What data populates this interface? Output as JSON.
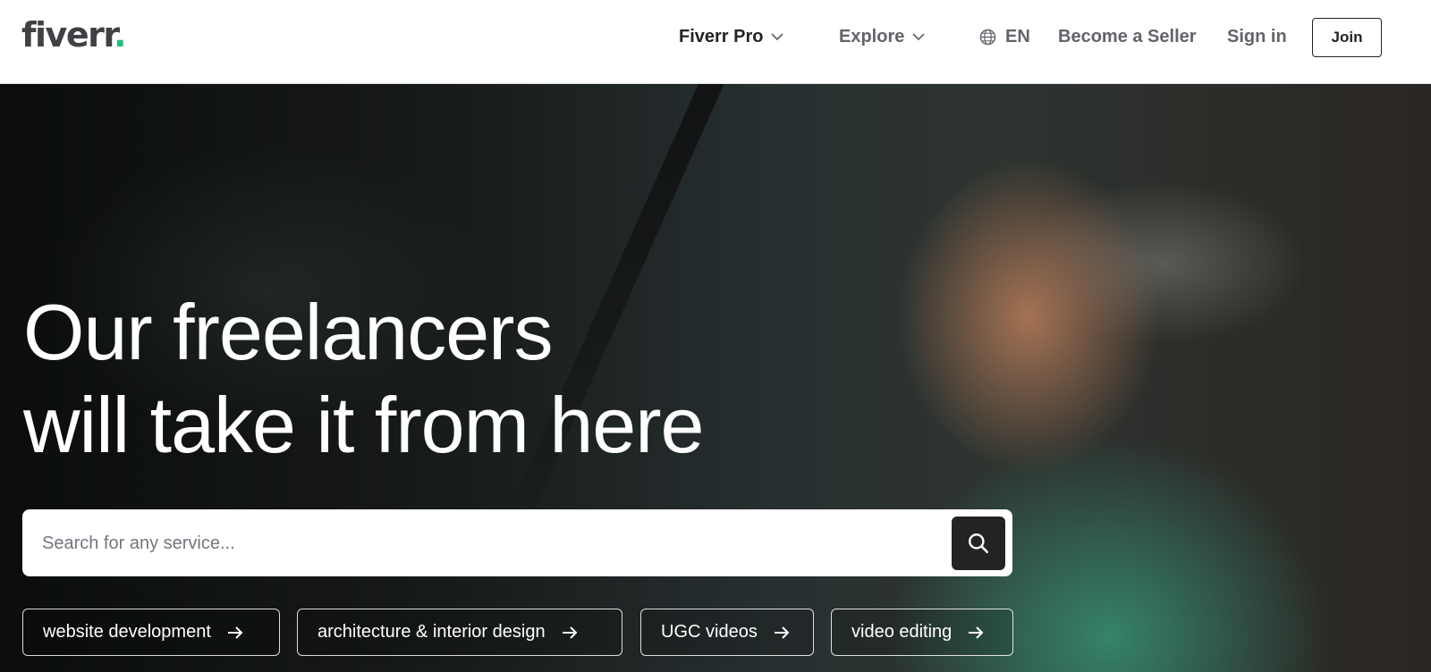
{
  "brand": {
    "logo_text": "fiverr",
    "logo_dot": ".",
    "dot_color": "#1dbf73"
  },
  "header": {
    "nav": {
      "fiverr_pro": "Fiverr Pro",
      "explore": "Explore",
      "language": "EN",
      "become_seller": "Become a Seller",
      "sign_in": "Sign in",
      "join": "Join"
    },
    "icons": {
      "dropdown": "chevron-down-icon",
      "language": "globe-icon"
    }
  },
  "hero": {
    "title_line1": "Our freelancers",
    "title_line2": "will take it from here",
    "search": {
      "placeholder": "Search for any service...",
      "value": "",
      "button_icon": "search-icon"
    },
    "chips": [
      {
        "label": "website development"
      },
      {
        "label": "architecture & interior design"
      },
      {
        "label": "UGC videos"
      },
      {
        "label": "video editing"
      }
    ],
    "chip_icon": "arrow-right-icon"
  },
  "colors": {
    "text_dark": "#222325",
    "text_muted": "#62646a",
    "accent": "#1dbf73",
    "search_button": "#222325"
  }
}
